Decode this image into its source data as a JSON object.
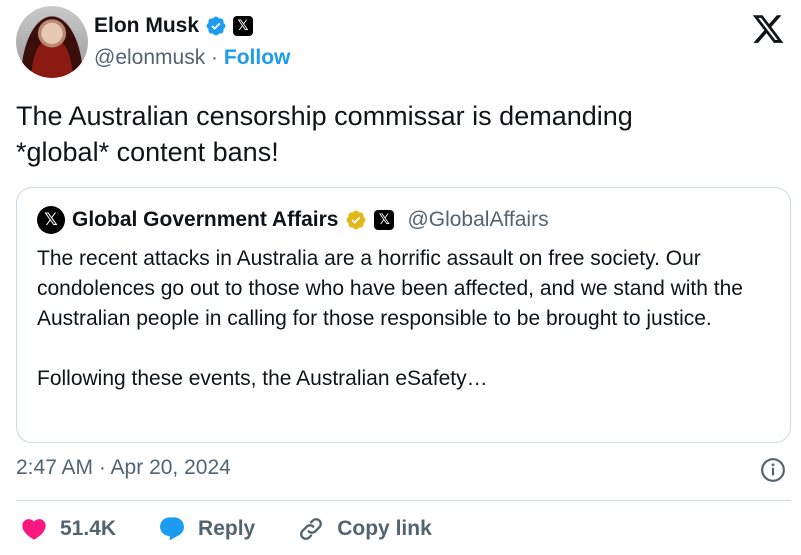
{
  "author": {
    "display_name": "Elon Musk",
    "handle": "@elonmusk",
    "separator": "·",
    "follow_label": "Follow"
  },
  "tweet": {
    "text_line1": "The Australian censorship commissar is demanding",
    "text_line2": "*global* content bans!",
    "timestamp": "2:47 AM · Apr 20, 2024"
  },
  "quote": {
    "avatar_glyph": "𝕏",
    "display_name": "Global Government Affairs",
    "handle": "@GlobalAffairs",
    "paragraph1": "The recent attacks in Australia are a horrific assault on free society. Our condolences go out to those who have been affected, and we stand with the Australian people in calling for those responsible to be brought to justice.",
    "paragraph2": "Following these events, the Australian eSafety…"
  },
  "actions": {
    "like_count": "51.4K",
    "reply_label": "Reply",
    "copy_link_label": "Copy link"
  },
  "colors": {
    "brand_blue": "#1d9bf0",
    "like_red": "#f91880",
    "gold_badge": "#e2b719",
    "muted_text": "#536471",
    "border": "#cfd9de"
  },
  "icons": [
    "verified-badge-icon",
    "x-badge-icon",
    "x-logo-icon",
    "gold-verified-badge-icon",
    "info-icon",
    "heart-icon",
    "reply-bubble-icon",
    "link-icon"
  ]
}
